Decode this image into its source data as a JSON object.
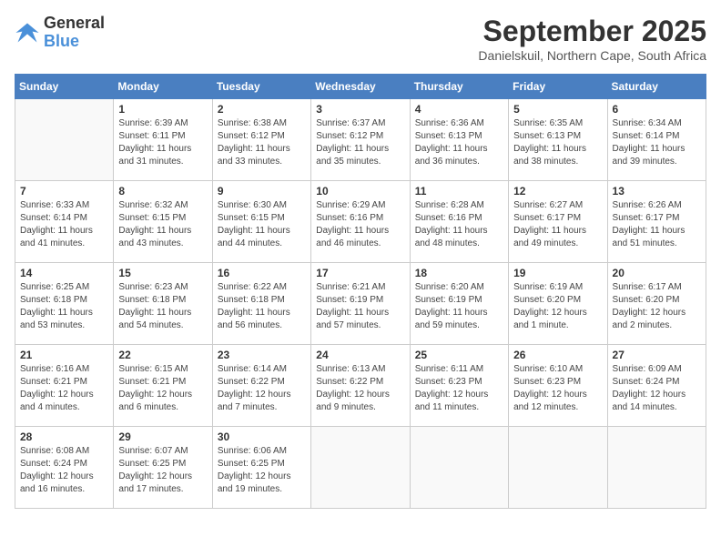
{
  "logo": {
    "line1": "General",
    "line2": "Blue"
  },
  "title": "September 2025",
  "subtitle": "Danielskuil, Northern Cape, South Africa",
  "days_of_week": [
    "Sunday",
    "Monday",
    "Tuesday",
    "Wednesday",
    "Thursday",
    "Friday",
    "Saturday"
  ],
  "weeks": [
    [
      {
        "day": "",
        "info": ""
      },
      {
        "day": "1",
        "info": "Sunrise: 6:39 AM\nSunset: 6:11 PM\nDaylight: 11 hours\nand 31 minutes."
      },
      {
        "day": "2",
        "info": "Sunrise: 6:38 AM\nSunset: 6:12 PM\nDaylight: 11 hours\nand 33 minutes."
      },
      {
        "day": "3",
        "info": "Sunrise: 6:37 AM\nSunset: 6:12 PM\nDaylight: 11 hours\nand 35 minutes."
      },
      {
        "day": "4",
        "info": "Sunrise: 6:36 AM\nSunset: 6:13 PM\nDaylight: 11 hours\nand 36 minutes."
      },
      {
        "day": "5",
        "info": "Sunrise: 6:35 AM\nSunset: 6:13 PM\nDaylight: 11 hours\nand 38 minutes."
      },
      {
        "day": "6",
        "info": "Sunrise: 6:34 AM\nSunset: 6:14 PM\nDaylight: 11 hours\nand 39 minutes."
      }
    ],
    [
      {
        "day": "7",
        "info": "Sunrise: 6:33 AM\nSunset: 6:14 PM\nDaylight: 11 hours\nand 41 minutes."
      },
      {
        "day": "8",
        "info": "Sunrise: 6:32 AM\nSunset: 6:15 PM\nDaylight: 11 hours\nand 43 minutes."
      },
      {
        "day": "9",
        "info": "Sunrise: 6:30 AM\nSunset: 6:15 PM\nDaylight: 11 hours\nand 44 minutes."
      },
      {
        "day": "10",
        "info": "Sunrise: 6:29 AM\nSunset: 6:16 PM\nDaylight: 11 hours\nand 46 minutes."
      },
      {
        "day": "11",
        "info": "Sunrise: 6:28 AM\nSunset: 6:16 PM\nDaylight: 11 hours\nand 48 minutes."
      },
      {
        "day": "12",
        "info": "Sunrise: 6:27 AM\nSunset: 6:17 PM\nDaylight: 11 hours\nand 49 minutes."
      },
      {
        "day": "13",
        "info": "Sunrise: 6:26 AM\nSunset: 6:17 PM\nDaylight: 11 hours\nand 51 minutes."
      }
    ],
    [
      {
        "day": "14",
        "info": "Sunrise: 6:25 AM\nSunset: 6:18 PM\nDaylight: 11 hours\nand 53 minutes."
      },
      {
        "day": "15",
        "info": "Sunrise: 6:23 AM\nSunset: 6:18 PM\nDaylight: 11 hours\nand 54 minutes."
      },
      {
        "day": "16",
        "info": "Sunrise: 6:22 AM\nSunset: 6:18 PM\nDaylight: 11 hours\nand 56 minutes."
      },
      {
        "day": "17",
        "info": "Sunrise: 6:21 AM\nSunset: 6:19 PM\nDaylight: 11 hours\nand 57 minutes."
      },
      {
        "day": "18",
        "info": "Sunrise: 6:20 AM\nSunset: 6:19 PM\nDaylight: 11 hours\nand 59 minutes."
      },
      {
        "day": "19",
        "info": "Sunrise: 6:19 AM\nSunset: 6:20 PM\nDaylight: 12 hours\nand 1 minute."
      },
      {
        "day": "20",
        "info": "Sunrise: 6:17 AM\nSunset: 6:20 PM\nDaylight: 12 hours\nand 2 minutes."
      }
    ],
    [
      {
        "day": "21",
        "info": "Sunrise: 6:16 AM\nSunset: 6:21 PM\nDaylight: 12 hours\nand 4 minutes."
      },
      {
        "day": "22",
        "info": "Sunrise: 6:15 AM\nSunset: 6:21 PM\nDaylight: 12 hours\nand 6 minutes."
      },
      {
        "day": "23",
        "info": "Sunrise: 6:14 AM\nSunset: 6:22 PM\nDaylight: 12 hours\nand 7 minutes."
      },
      {
        "day": "24",
        "info": "Sunrise: 6:13 AM\nSunset: 6:22 PM\nDaylight: 12 hours\nand 9 minutes."
      },
      {
        "day": "25",
        "info": "Sunrise: 6:11 AM\nSunset: 6:23 PM\nDaylight: 12 hours\nand 11 minutes."
      },
      {
        "day": "26",
        "info": "Sunrise: 6:10 AM\nSunset: 6:23 PM\nDaylight: 12 hours\nand 12 minutes."
      },
      {
        "day": "27",
        "info": "Sunrise: 6:09 AM\nSunset: 6:24 PM\nDaylight: 12 hours\nand 14 minutes."
      }
    ],
    [
      {
        "day": "28",
        "info": "Sunrise: 6:08 AM\nSunset: 6:24 PM\nDaylight: 12 hours\nand 16 minutes."
      },
      {
        "day": "29",
        "info": "Sunrise: 6:07 AM\nSunset: 6:25 PM\nDaylight: 12 hours\nand 17 minutes."
      },
      {
        "day": "30",
        "info": "Sunrise: 6:06 AM\nSunset: 6:25 PM\nDaylight: 12 hours\nand 19 minutes."
      },
      {
        "day": "",
        "info": ""
      },
      {
        "day": "",
        "info": ""
      },
      {
        "day": "",
        "info": ""
      },
      {
        "day": "",
        "info": ""
      }
    ]
  ]
}
